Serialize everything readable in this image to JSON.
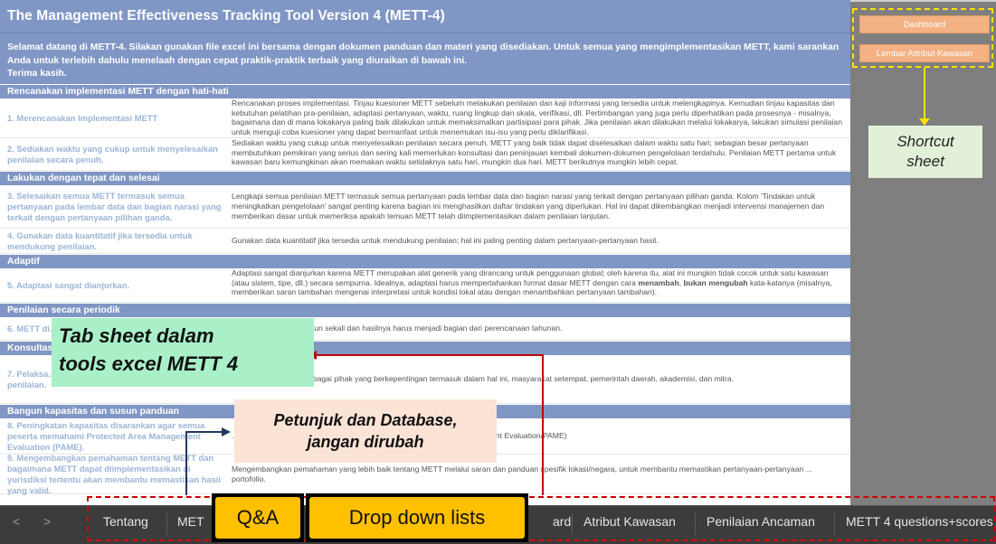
{
  "title": "The Management Effectiveness Tracking Tool Version 4 (METT-4)",
  "welcome": "Selamat datang di METT-4. Silakan gunakan file excel ini bersama dengan dokumen panduan dan materi yang disediakan. Untuk semua yang mengimplementasikan METT, kami sarankan Anda untuk terlebih dahulu menelaah dengan cepat praktik-praktik terbaik yang diuraikan di bawah ini.\nTerima kasih.",
  "sections": {
    "s1": "Rencanakan implementasi METT dengan hati-hati",
    "s2": "Lakukan dengan tepat dan selesai",
    "s3": "Adaptif",
    "s4": "Penilaian secara periodik",
    "s5": "Konsultasi",
    "s6": "Bangun kapasitas dan susun panduan"
  },
  "rows": {
    "r1": {
      "left": "1. Merencanakan Implementasi METT",
      "right": "Rencanakan proses implementasi. Tinjau kuesioner METT sebelum melakukan penilaian dan kaji informasi yang tersedia untuk melengkapinya. Kemudian tinjau kapasitas dan kebutuhan pelatihan pra-penilaian, adaptasi pertanyaan, waktu, ruang lingkup dan skala, verifikasi, dll. Pertimbangan yang juga perlu diperhatikan pada prosesnya - misalnya, bagaimana dan di mana lokakarya paling baik dilakukan untuk memaksimalkan partisipasi para pihak. Jika penilaian akan dilakukan melalui lokakarya, lakukan simulasi penilaian untuk menguji coba kuesioner yang dapat bermanfaat untuk menemukan isu-isu yang perlu diklarifikasi."
    },
    "r2": {
      "left": "2. Sediakan waktu yang cukup untuk menyelesaikan penilaian secara penuh.",
      "right": "Sediakan waktu yang cukup untuk menyelesaikan penilaian secara penuh. METT yang baik tidak dapat diselesaikan dalam waktu satu hari; sebagian besar pertanyaan membutuhkan pemikiran yang serius dan sering kali memerlukan konsultasi dan peninjauan kembali dokumen-dokumen pengelolaan terdahulu. Penilaian METT pertama untuk kawasan baru kemungkinan akan memakan waktu setidaknya satu hari, mungkin dua hari. METT berikutnya mungkin lebih cepat."
    },
    "r3": {
      "left": "3. Selesaikan semua METT termasuk semua pertanyaan pada lembar data dan bagian narasi yang terkait dengan pertanyaan pilihan ganda.",
      "right": "Lengkapi semua penilaian METT termasuk semua pertanyaan pada lembar data dan bagian narasi yang terkait dengan pertanyaan pilihan ganda. Kolom 'Tindakan untuk meningkatkan pengelolaan' sangat penting karena bagian ini menghasilkan daftar tindakan yang diperlukan. Hal ini dapat dikembangkan menjadi intervensi manajemen dan memberikan dasar untuk memeriksa apakah temuan METT telah diimplementasikan dalam penilaian lanjutan."
    },
    "r4": {
      "left": "4. Gunakan data kuantitatif jika tersedia untuk mendukung penilaian.",
      "right": "Gunakan data kuantitatif jika tersedia untuk mendukung penilaian; hal ini paling penting dalam pertanyaan-pertanyaan hasil."
    },
    "r5": {
      "left": "5. Adaptasi sangat dianjurkan.",
      "right_a": "Adaptasi sangat dianjurkan karena METT merupakan alat generik yang dirancang untuk penggunaan global; oleh karena itu, alat ini mungkin tidak cocok untuk satu kawasan (atau sistem, tipe, dll.) secara sempurna. Idealnya, adaptasi harus mempertahankan format dasar METT dengan cara ",
      "right_b1": "menambah",
      "right_c": ", ",
      "right_b2": "bukan mengubah",
      "right_d": " kata-katanya (misalnya, memberikan saran tambahan mengenai interpretasi untuk kondisi lokal atau dengan menambahkan pertanyaan tambahan)."
    },
    "r6": {
      "left": "6. METT di... waktu ke w...",
      "right": "...akukan setiap dua tahun sekali dan hasilnya harus menjadi bagian dari perencanaan tahunan."
    },
    "r7": {
      "left": "7. Pelaksa... melibatkan... kepentinga... tentang hasil penilaian.",
      "right": "...engan melibatkan berbagai pihak yang berkepentingan termasuk dalam hal ini, masyarakat setempat, pemerintah daerah, akademisi, dan mitra."
    },
    "r8": {
      "left": "8. Peningkatan kapasitas disarankan agar semua peserta memahami Protected Area Management Evaluation (PAME).",
      "right": "...ep Evaluasi Pengelolaan Kawasan Konservasi (Protected Area Management Evaluation/PAME)"
    },
    "r9": {
      "left": "9. Mengembangkan pemahaman tentang METT dan bagaimana METT dapat diimplementasikan di yurisdiksi tertentu akan membantu memastikan hasil yang valid.",
      "right": "Mengembangkan pemahaman yang lebih baik tentang METT melalui saran dan panduan spesifik lokasi/negara, untuk membantu memastikan pertanyaan-pertanyaan ... portofolio."
    }
  },
  "buttons": {
    "dashboard": "Dashboard",
    "lembar": "Lembar Attribut Kawasan"
  },
  "annotations": {
    "shortcut": "Shortcut\nsheet",
    "tab_sheet": "Tab sheet dalam\ntools excel METT 4",
    "petunjuk": "Petunjuk dan Database,\njangan dirubah",
    "qa": "Q&A",
    "dropdown": "Drop down lists"
  },
  "tabs": {
    "prev": "<",
    "next": ">",
    "t1": "Tentang",
    "t2": "MET",
    "t3": "ard",
    "t4": "Atribut Kawasan",
    "t5": "Penilaian Ancaman",
    "t6": "METT 4 questions+scores"
  },
  "colors": {
    "header_blue": "#8096c4",
    "label_blue": "#9ab5d6",
    "button_orange": "#f4b183",
    "highlight_yellow": "#ffe100",
    "annotation_red": "#d00000",
    "chip_gold": "#ffc000"
  }
}
